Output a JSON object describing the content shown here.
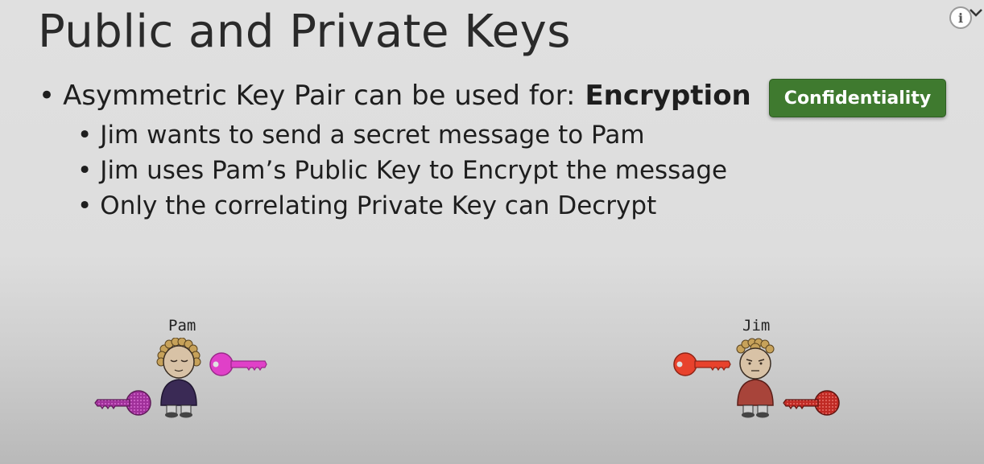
{
  "slide": {
    "title": "Public and Private Keys",
    "bullet_main_text": "Asymmetric Key Pair can be used for:",
    "bullet_main_bold": "Encryption",
    "sub_bullets": [
      "Jim wants to send a secret message to Pam",
      "Jim uses Pam’s Public Key to Encrypt the message",
      "Only the correlating Private Key can Decrypt"
    ],
    "badge": "Confidentiality",
    "bullet_symbol": "•"
  },
  "people": {
    "pam": {
      "name": "Pam",
      "public_key_color": "#e040c8",
      "private_key_color": "#a0309a"
    },
    "jim": {
      "name": "Jim",
      "public_key_color": "#e8422c",
      "private_key_color": "#c02a24"
    }
  },
  "player": {
    "info_icon": "i"
  },
  "colors": {
    "badge_green": "#3f7a2f",
    "pam_shirt": "#3a2a55",
    "jim_shirt": "#a8443a"
  }
}
